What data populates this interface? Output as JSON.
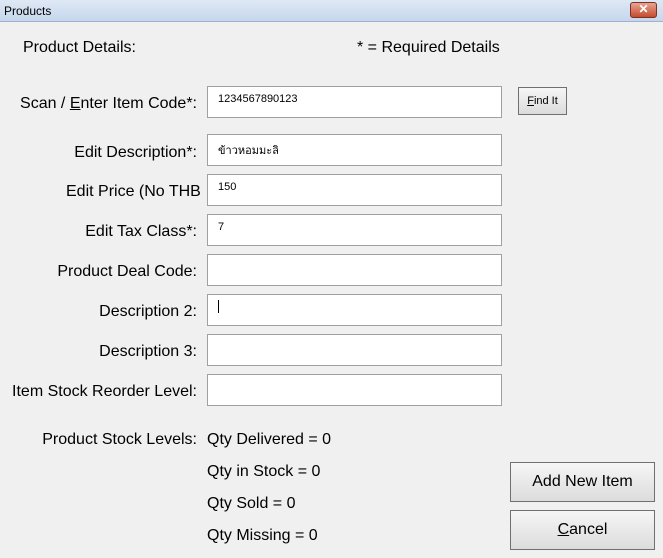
{
  "window": {
    "title": "Products",
    "close_label": "✕"
  },
  "header": {
    "section_label": "Product Details:",
    "required_note": "* = Required Details"
  },
  "form": {
    "item_code": {
      "label_prefix": "Scan / ",
      "label_accel": "E",
      "label_suffix": "nter Item Code*:",
      "value": "1234567890123"
    },
    "description": {
      "label": "Edit Description*:",
      "value": "ข้าวหอมมะลิ"
    },
    "price": {
      "label": "Edit Price (No THB Sign)*:",
      "value": "150"
    },
    "tax_class": {
      "label": "Edit Tax Class*:",
      "value": "7"
    },
    "deal_code": {
      "label": "Product Deal Code:",
      "value": ""
    },
    "description2": {
      "label": "Description 2:",
      "value": ""
    },
    "description3": {
      "label": "Description 3:",
      "value": ""
    },
    "reorder_level": {
      "label": "Item Stock Reorder Level:",
      "value": ""
    }
  },
  "find_button": {
    "accel": "F",
    "rest": "ind It"
  },
  "stock": {
    "label": "Product Stock Levels:",
    "delivered": "Qty Delivered = 0",
    "in_stock": "Qty in Stock = 0",
    "sold": "Qty Sold = 0",
    "missing": "Qty Missing = 0"
  },
  "buttons": {
    "add_new": "Add New Item",
    "cancel_accel": "C",
    "cancel_rest": "ancel"
  }
}
